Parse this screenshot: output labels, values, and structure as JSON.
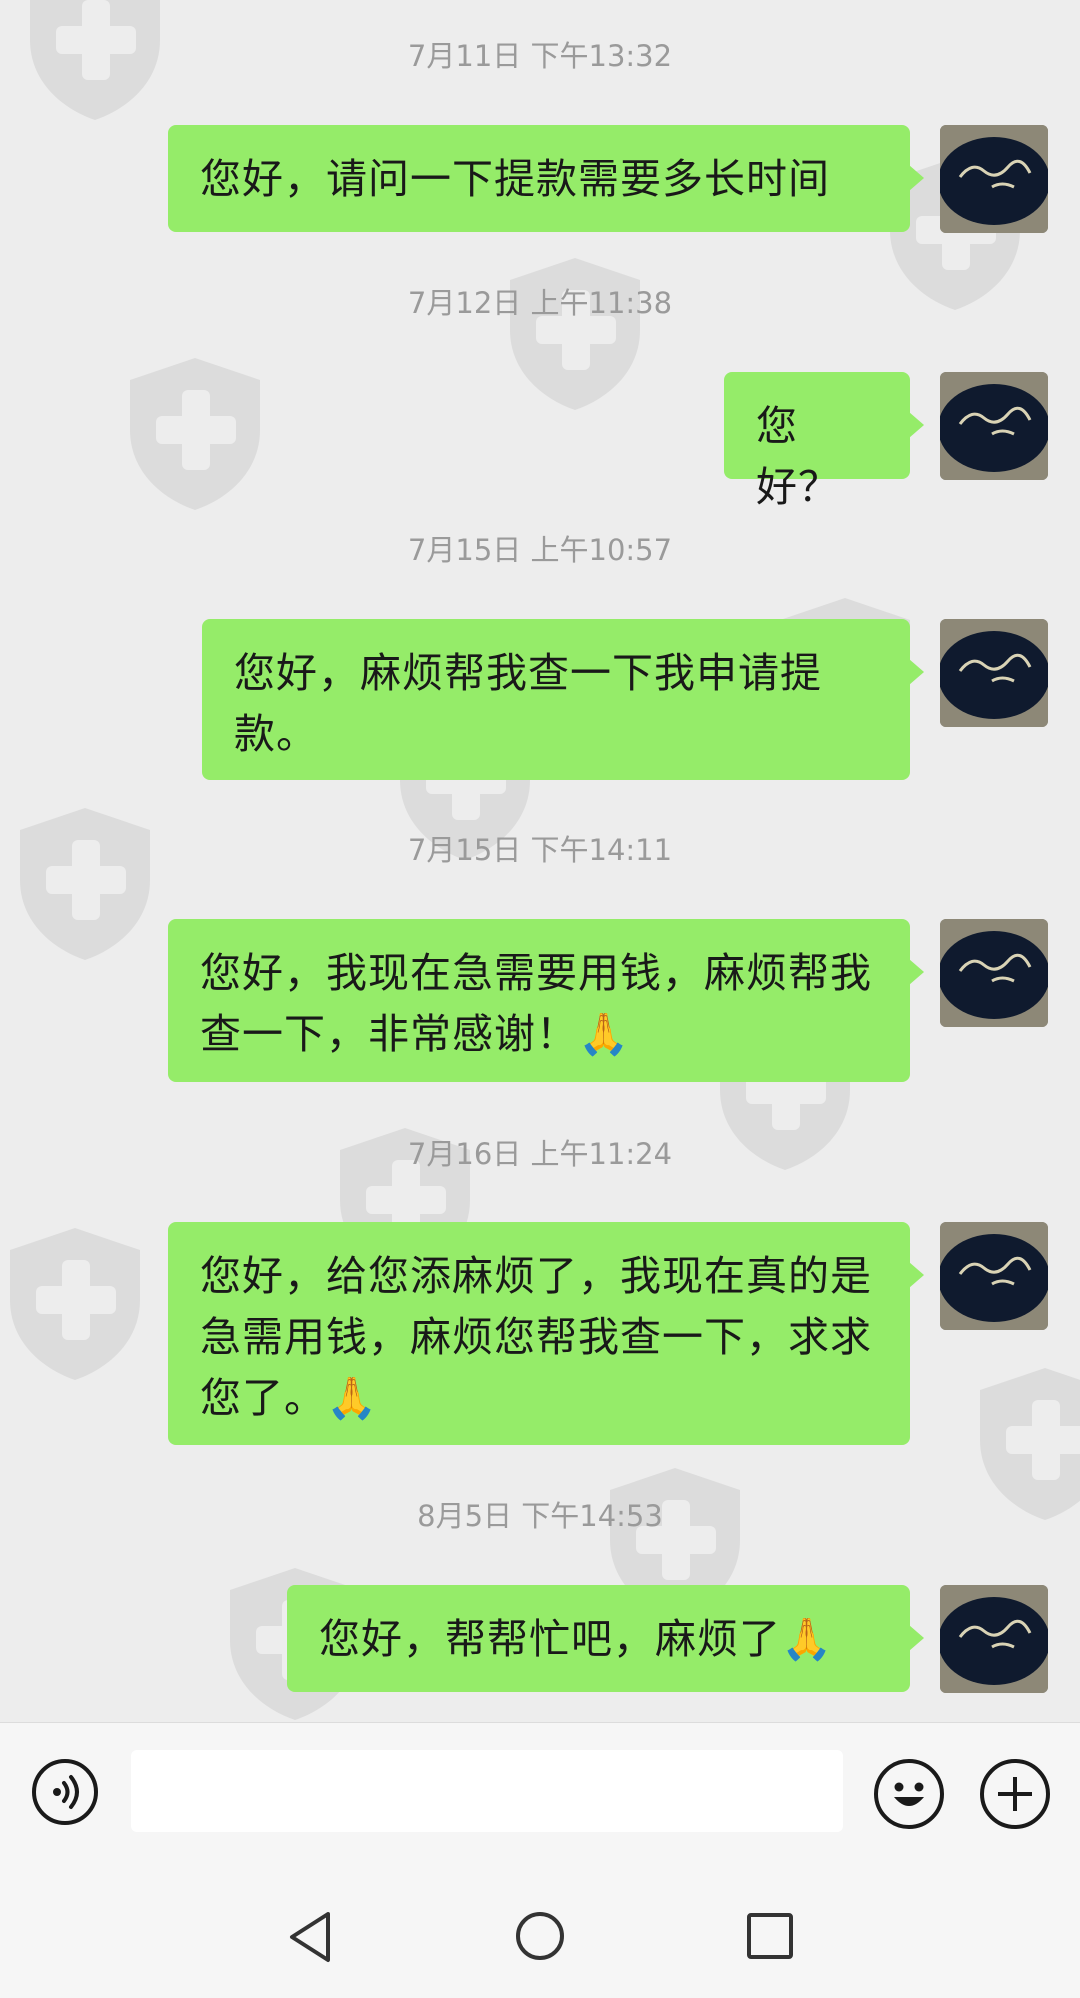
{
  "messages": [
    {
      "time": "7月11日 下午13:32",
      "text": "您好，请问一下提款需要多长时间"
    },
    {
      "time": "7月12日 上午11:38",
      "text": "您好？"
    },
    {
      "time": "7月15日 上午10:57",
      "text": "您好，麻烦帮我查一下我申请提款。"
    },
    {
      "time": "7月15日 下午14:11",
      "text": "您好，我现在急需要用钱，麻烦帮我查一下，非常感谢！🙏"
    },
    {
      "time": "7月16日 上午11:24",
      "text": "您好，给您添麻烦了，我现在真的是急需用钱，麻烦您帮我查一下，求求您了。🙏"
    },
    {
      "time": "8月5日 下午14:53",
      "text": "您好，帮帮忙吧，麻烦了🙏"
    }
  ],
  "input": {
    "voice_icon": "voice-icon",
    "emoji_icon": "emoji-icon",
    "plus_icon": "plus-icon",
    "placeholder": ""
  },
  "colors": {
    "bubble": "#95ec69",
    "background": "#ededed",
    "timestamp": "#9a9a9a"
  },
  "watermark_icon": "shield-plus-icon",
  "nav": {
    "back_icon": "back-icon",
    "home_icon": "home-icon",
    "recents_icon": "recents-icon"
  }
}
